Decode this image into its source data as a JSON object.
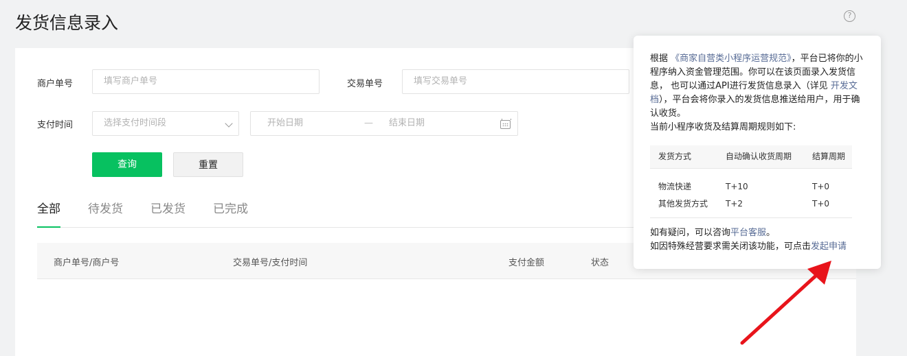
{
  "page": {
    "title": "发货信息录入"
  },
  "filters": {
    "merchant_no_label": "商户单号",
    "merchant_no_placeholder": "填写商户单号",
    "trade_no_label": "交易单号",
    "trade_no_placeholder": "填写交易单号",
    "pay_time_label": "支付时间",
    "pay_period_placeholder": "选择支付时间段",
    "start_date_placeholder": "开始日期",
    "range_separator": "—",
    "end_date_placeholder": "结束日期",
    "query_button": "查询",
    "reset_button": "重置"
  },
  "tabs": [
    {
      "label": "全部",
      "active": true
    },
    {
      "label": "待发货",
      "active": false
    },
    {
      "label": "已发货",
      "active": false
    },
    {
      "label": "已完成",
      "active": false
    }
  ],
  "table": {
    "columns": [
      "商户单号/商户号",
      "交易单号/支付时间",
      "支付金额",
      "状态"
    ]
  },
  "popover": {
    "intro_prefix": "根据",
    "rule_link": "《商家自营类小程序运营规范》",
    "intro_mid": "，平台已将你的小程序纳入资金管理范围。你可以在该页面录入发货信息， 也可以通过API进行发货信息录入（详见",
    "dev_doc_link": "开发文档",
    "intro_suffix": "），平台会将你录入的发货信息推送给用户，用于确认收货。",
    "rules_intro": "当前小程序收货及结算周期规则如下:",
    "rules_headers": [
      "发货方式",
      "自动确认收货周期",
      "结算周期"
    ],
    "rules_rows": [
      [
        "物流快递",
        "T+10",
        "T+0"
      ],
      [
        "其他发货方式",
        "T+2",
        "T+0"
      ]
    ],
    "question_prefix": "如有疑问，可以咨询",
    "service_link": "平台客服",
    "question_suffix": "。",
    "disable_prefix": "如因特殊经营要求需关闭该功能，可点击",
    "apply_link": "发起申请"
  },
  "colors": {
    "primary": "#07c160",
    "link": "#576b95",
    "arrow": "#e8141b"
  },
  "icons": [
    "help-icon",
    "chevron-down-icon",
    "calendar-icon",
    "red-arrow-annotation"
  ]
}
